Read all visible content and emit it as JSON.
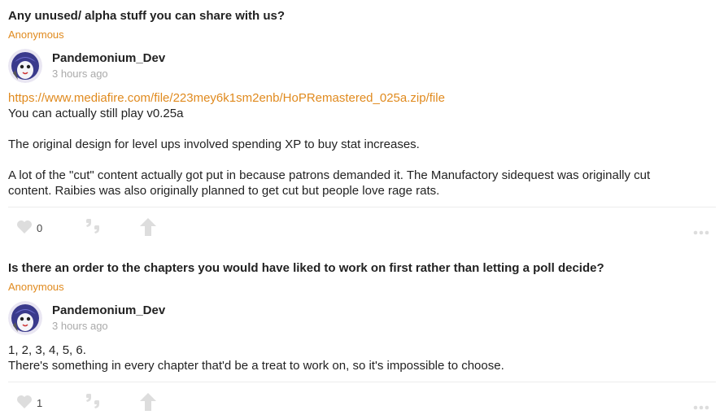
{
  "posts": [
    {
      "question": "Any unused/ alpha stuff you can share with us?",
      "asker": "Anonymous",
      "author": "Pandemonium_Dev",
      "time": "3 hours ago",
      "link": "https://www.mediafire.com/file/223mey6k1sm2enb/HoPRemastered_025a.zip/file",
      "lines": [
        "You can actually still play v0.25a",
        "The original design for level ups involved spending XP to buy stat increases.",
        "A lot of the \"cut\" content actually got put in because patrons demanded it. The Manufactory sidequest was originally cut",
        "content. Raibies was also originally planned to get cut but people love rage rats."
      ],
      "likes": "0"
    },
    {
      "question": "Is there an order to the chapters you would have liked to work on first rather than letting a poll decide?",
      "asker": "Anonymous",
      "author": "Pandemonium_Dev",
      "time": "3 hours ago",
      "lines": [
        "1, 2, 3, 4, 5, 6.",
        "There's something in every chapter that'd be a treat to work on, so it's impossible to choose."
      ],
      "likes": "1"
    }
  ],
  "icons": {
    "like": "heart-icon",
    "quote": "quote-icon",
    "upvote": "arrow-up-icon",
    "more": "more-icon"
  },
  "colors": {
    "accent": "#e08a1e",
    "icon": "#dddddd",
    "muted": "#aaaaaa"
  }
}
